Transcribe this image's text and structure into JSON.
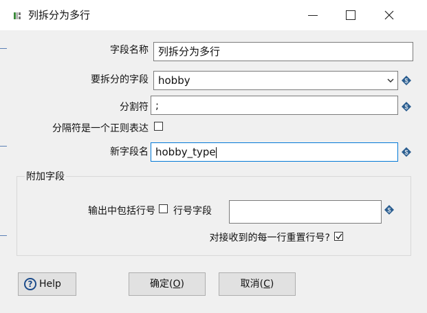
{
  "window": {
    "title": "列拆分为多行"
  },
  "form": {
    "field_name_label": "字段名称",
    "field_name_value": "列拆分为多行",
    "split_field_label": "要拆分的字段",
    "split_field_value": "hobby",
    "delimiter_label": "分割符",
    "delimiter_value": ";",
    "regex_label": "分隔符是一个正则表达",
    "regex_checked": false,
    "new_field_label": "新字段名",
    "new_field_value": "hobby_type"
  },
  "additional": {
    "group_title": "附加字段",
    "include_rownum_label": "输出中包括行号",
    "include_rownum_checked": false,
    "rownum_field_label": "行号字段",
    "rownum_field_value": "",
    "reset_rownum_label": "对接收到的每一行重置行号?",
    "reset_rownum_checked": true
  },
  "buttons": {
    "help": "Help",
    "ok_prefix": "确定(",
    "ok_key": "O",
    "ok_suffix": ")",
    "cancel_prefix": "取消(",
    "cancel_key": "C",
    "cancel_suffix": ")"
  },
  "colors": {
    "focus_border": "#0078d7",
    "variable_icon": "#2a5d8f"
  }
}
